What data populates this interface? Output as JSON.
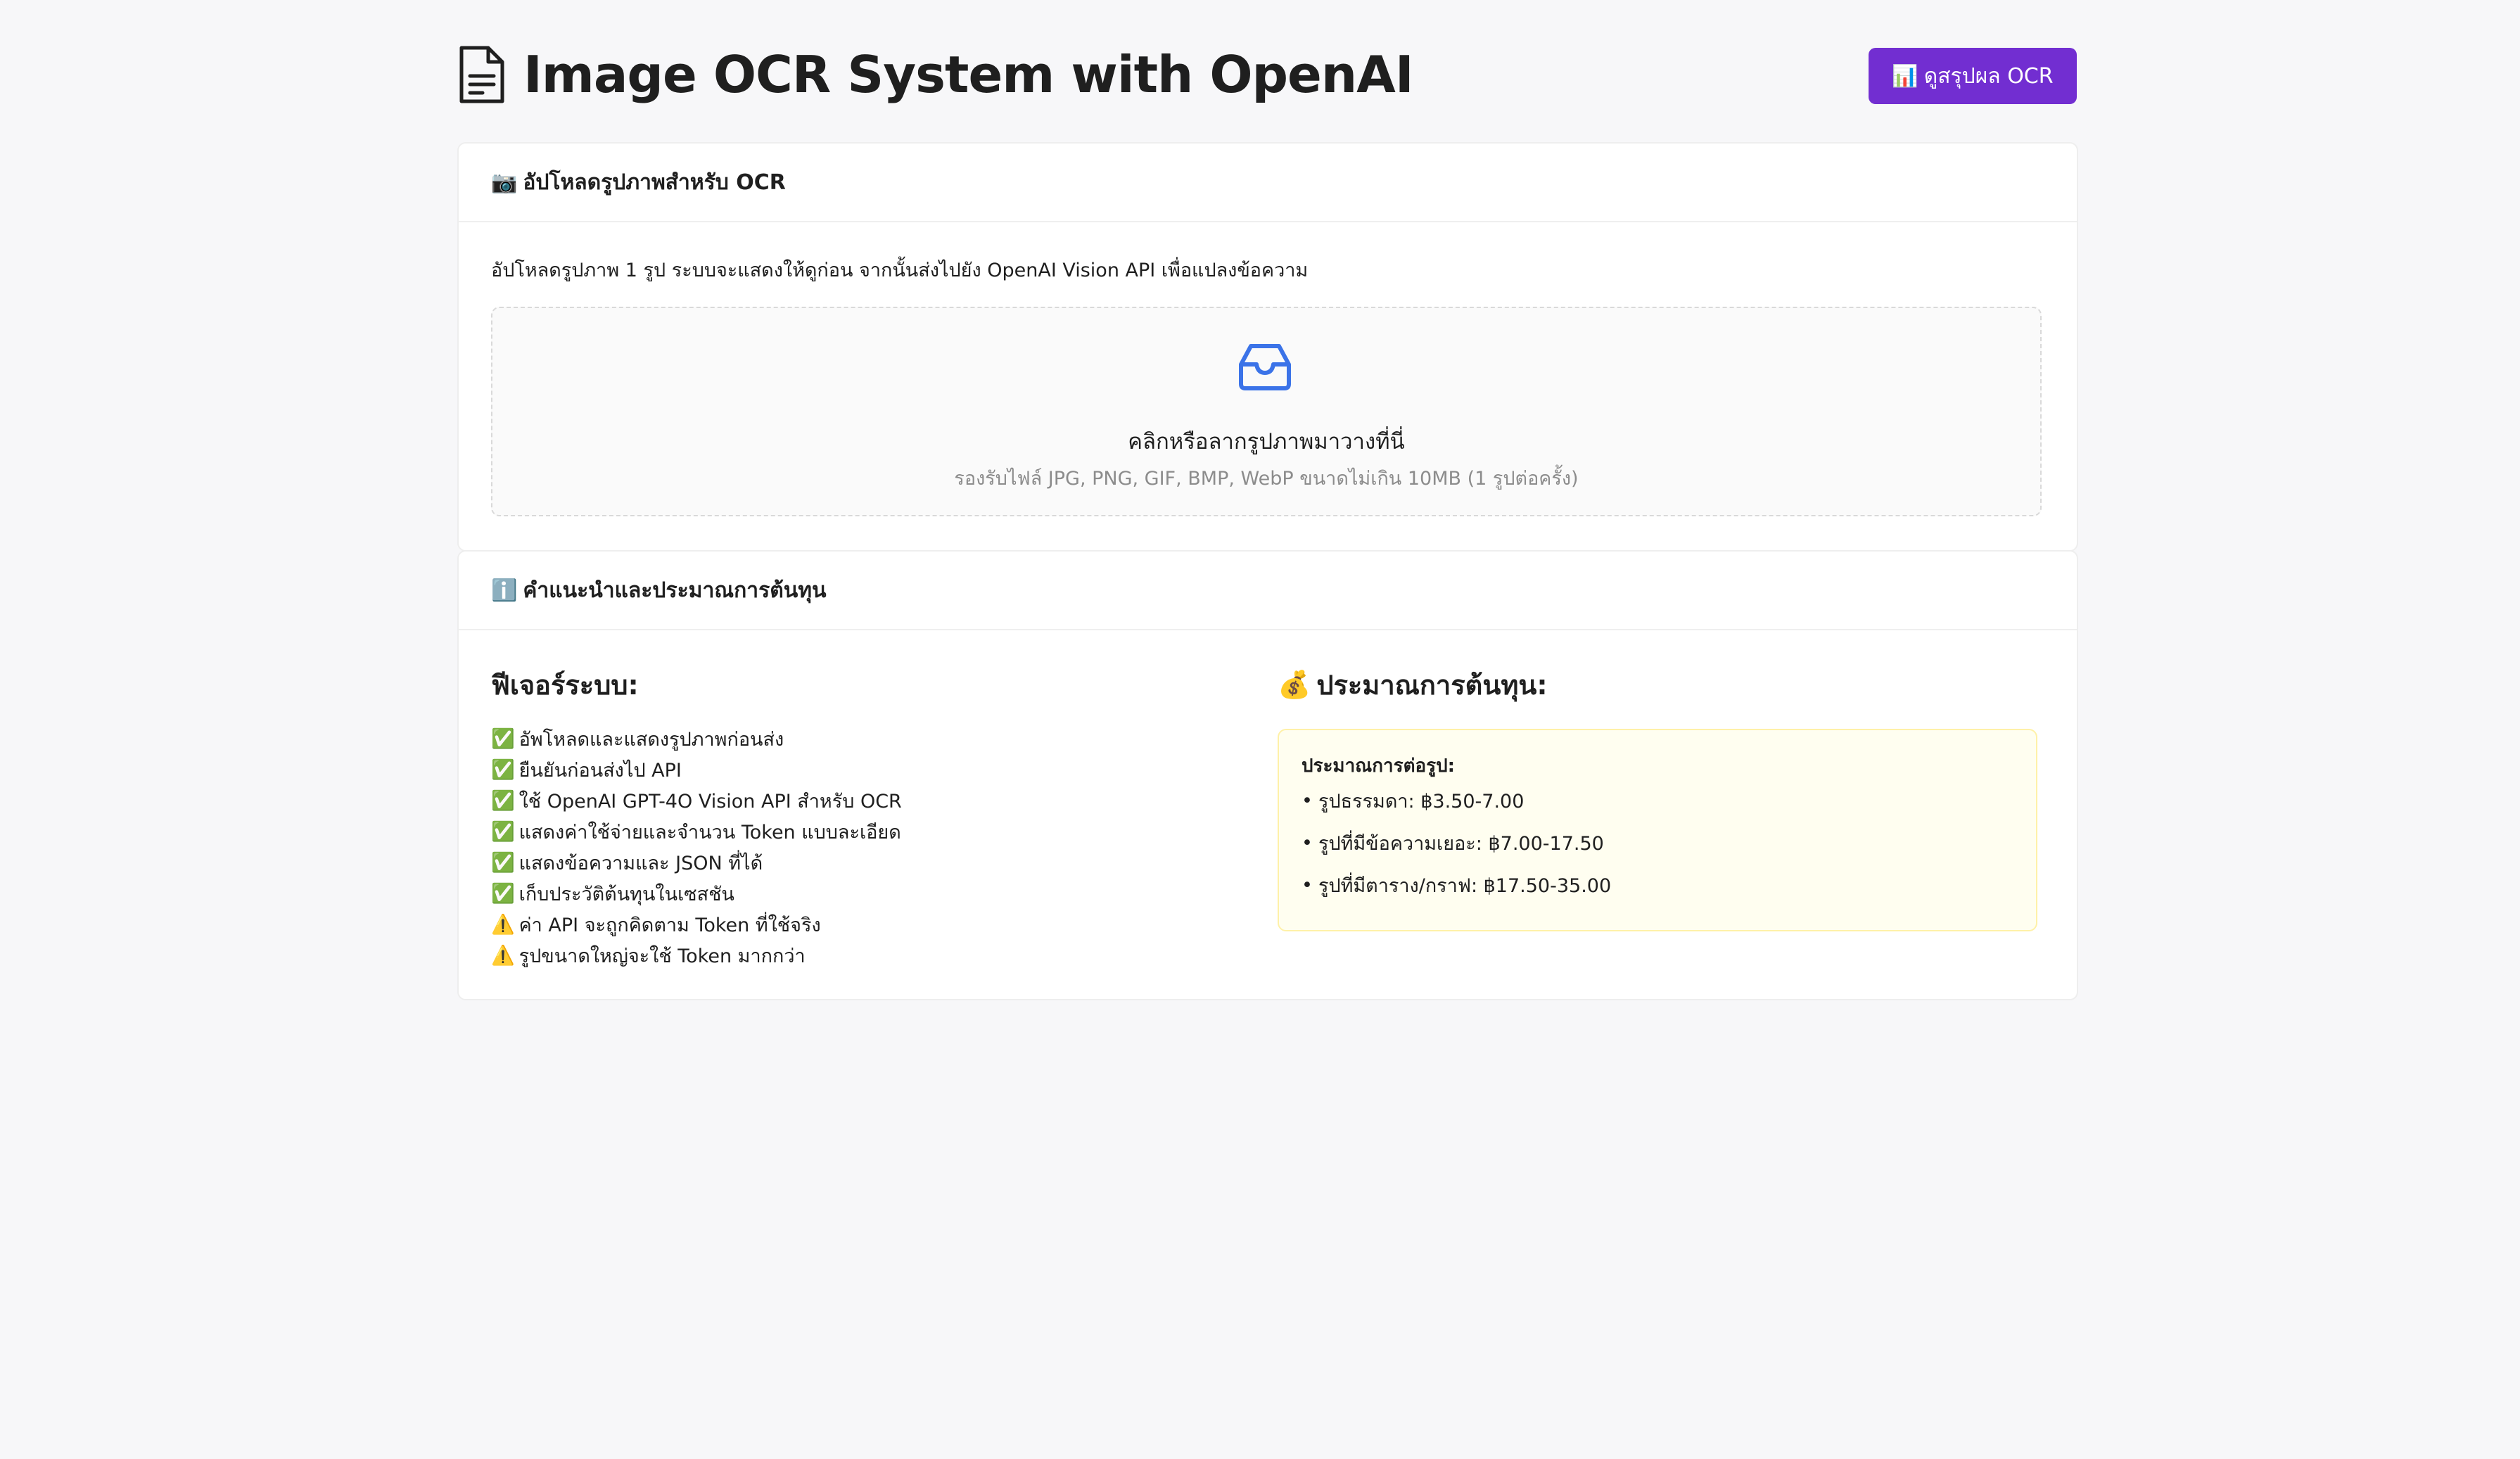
{
  "header": {
    "title": "Image OCR System with OpenAI",
    "title_icon": "document-icon",
    "summary_button": {
      "emoji": "📊",
      "label": "ดูสรุปผล OCR"
    }
  },
  "upload_card": {
    "emoji": "📷",
    "title": "อัปโหลดรูปภาพสำหรับ OCR",
    "description": "อัปโหลดรูปภาพ 1 รูป ระบบจะแสดงให้ดูก่อน จากนั้นส่งไปยัง OpenAI Vision API เพื่อแปลงข้อความ",
    "dropzone": {
      "icon": "inbox-icon",
      "title": "คลิกหรือลากรูปภาพมาวางที่นี่",
      "hint": "รองรับไฟล์ JPG, PNG, GIF, BMP, WebP ขนาดไม่เกิน 10MB (1 รูปต่อครั้ง)"
    }
  },
  "info_card": {
    "emoji": "ℹ️",
    "title": "คำแนะนำและประมาณการต้นทุน",
    "features": {
      "title": "ฟีเจอร์ระบบ:",
      "items": [
        {
          "mark": "✅",
          "text": "อัพโหลดและแสดงรูปภาพก่อนส่ง"
        },
        {
          "mark": "✅",
          "text": "ยืนยันก่อนส่งไป API"
        },
        {
          "mark": "✅",
          "text": "ใช้ OpenAI GPT-4O Vision API สำหรับ OCR"
        },
        {
          "mark": "✅",
          "text": "แสดงค่าใช้จ่ายและจำนวน Token แบบละเอียด"
        },
        {
          "mark": "✅",
          "text": "แสดงข้อความและ JSON ที่ได้"
        },
        {
          "mark": "✅",
          "text": "เก็บประวัติต้นทุนในเซสชัน"
        },
        {
          "mark": "⚠️",
          "text": "ค่า API จะถูกคิดตาม Token ที่ใช้จริง"
        },
        {
          "mark": "⚠️",
          "text": "รูปขนาดใหญ่จะใช้ Token มากกว่า"
        }
      ]
    },
    "cost": {
      "emoji": "💰",
      "title": "ประมาณการต้นทุน:",
      "box_title": "ประมาณการต่อรูป:",
      "items": [
        {
          "bullet": "•",
          "text": "รูปธรรมดา: ฿3.50-7.00"
        },
        {
          "bullet": "•",
          "text": "รูปที่มีข้อความเยอะ: ฿7.00-17.50"
        },
        {
          "bullet": "•",
          "text": "รูปที่มีตาราง/กราฟ: ฿17.50-35.00"
        }
      ]
    }
  },
  "colors": {
    "background": "#f7f7f9",
    "accent": "#722ed1",
    "icon_blue": "#3b73e8",
    "cost_box_bg": "#fffef0",
    "cost_box_border": "#fff1a8"
  }
}
